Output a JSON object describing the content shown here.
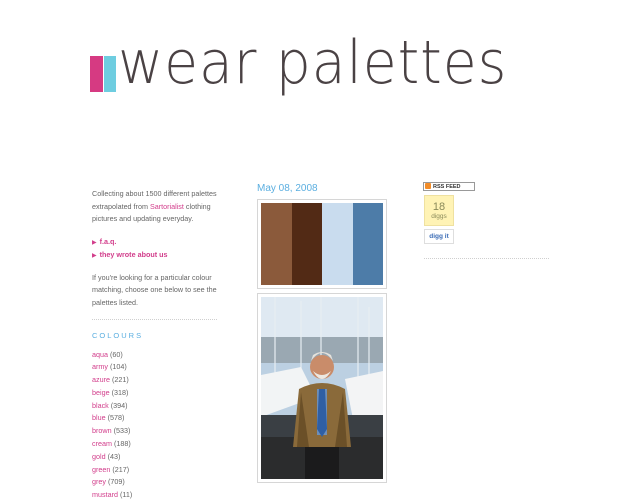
{
  "site": {
    "title": "wear palettes"
  },
  "sidebar": {
    "intro_prefix": "Collecting about 1500 different palettes extrapolated from ",
    "intro_link": "Sartorialist",
    "intro_suffix": " clothing pictures and updating everyday.",
    "nav": [
      {
        "label": "f.a.q."
      },
      {
        "label": "they wrote about us"
      }
    ],
    "matching_text": "If you're looking for a particular colour matching, choose one below to see the palettes listed.",
    "colours_title": "COLOURS",
    "colours": [
      {
        "name": "aqua",
        "count": "(60)"
      },
      {
        "name": "army",
        "count": "(104)"
      },
      {
        "name": "azure",
        "count": "(221)"
      },
      {
        "name": "beige",
        "count": "(318)"
      },
      {
        "name": "black",
        "count": "(394)"
      },
      {
        "name": "blue",
        "count": "(578)"
      },
      {
        "name": "brown",
        "count": "(533)"
      },
      {
        "name": "cream",
        "count": "(188)"
      },
      {
        "name": "gold",
        "count": "(43)"
      },
      {
        "name": "green",
        "count": "(217)"
      },
      {
        "name": "grey",
        "count": "(709)"
      },
      {
        "name": "mustard",
        "count": "(11)"
      }
    ]
  },
  "post": {
    "date": "May 08, 2008",
    "palette": [
      "#8b5a3b",
      "#522a15",
      "#c9dcee",
      "#4d7ca8"
    ]
  },
  "right": {
    "rss_label": "RSS FEED",
    "digg_count": "18",
    "digg_label": "diggs",
    "digg_it": "digg it"
  },
  "colors": {
    "accent_pink": "#d23d8b",
    "accent_blue": "#5aaee0",
    "logo_pink": "#d63a82",
    "logo_cyan": "#6ecde0",
    "logo_dark": "#4a4244"
  }
}
